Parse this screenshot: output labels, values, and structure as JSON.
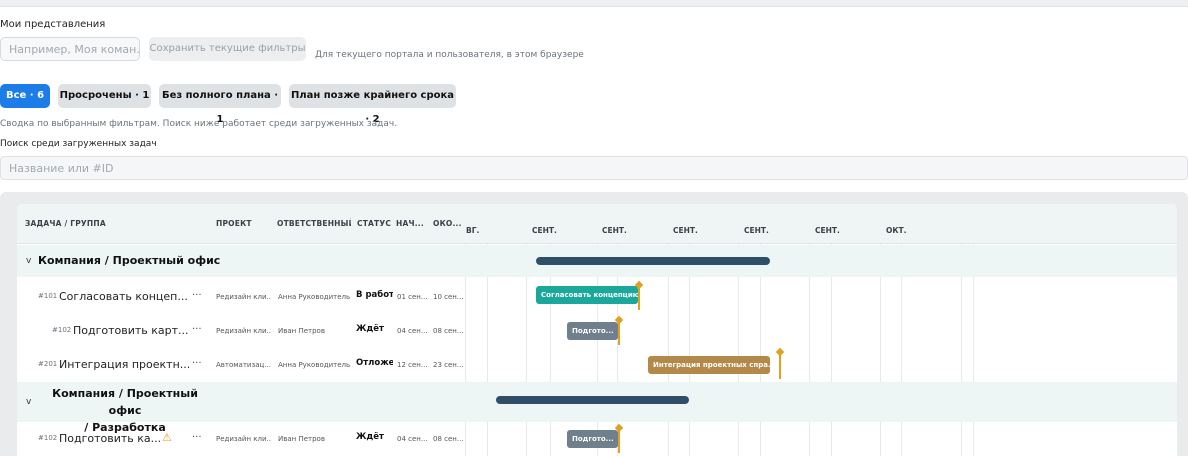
{
  "views": {
    "label": "Мои представления",
    "input_placeholder": "Например, Моя коман...",
    "save_button": "Сохранить текущие фильтры",
    "hint": "Для текущего портала и пользователя, в этом браузере"
  },
  "filters": [
    {
      "label": "Все · 6",
      "active": true
    },
    {
      "label": "Просрочены · 1",
      "active": false
    },
    {
      "label": "Без полного плана · 1",
      "active": false
    },
    {
      "label": "План позже крайнего срока · 2",
      "active": false
    }
  ],
  "summary": "Сводка по выбранным фильтрам. Поиск ниже работает среди загруженных задач.",
  "search": {
    "label": "Поиск среди загруженных задач",
    "placeholder": "Название или #ID"
  },
  "gantt": {
    "columns": {
      "task": "ЗАДАЧА / ГРУППА",
      "project": "ПРОЕКТ",
      "assignee": "ОТВЕТСТВЕННЫЙ",
      "status": "СТАТУС",
      "start": "НАЧ...",
      "end": "ОКО..."
    },
    "timeline_labels": [
      "ВГ.",
      "СЕНТ.",
      "СЕНТ.",
      "СЕНТ.",
      "СЕНТ.",
      "СЕНТ.",
      "ОКТ."
    ],
    "groups": [
      {
        "chevron": "v",
        "title": "Компания / Проектный офис",
        "tasks": [
          {
            "id": "#101",
            "name": "Согласовать концеп...",
            "more": "···",
            "project": "Редизайн кли...",
            "assignee": "Анна Руководитель",
            "status": "В работе",
            "start": "01 сен...",
            "end": "10 сен...",
            "bar_label": "Согласовать концепцию...",
            "bar_color": "#1aa89c",
            "warning": false
          },
          {
            "id": "#102",
            "name": "Подготовить карт...",
            "more": "···",
            "project": "Редизайн кли...",
            "assignee": "Иван Петров",
            "status": "Ждёт",
            "start": "04 сен...",
            "end": "08 сен...",
            "bar_label": "Подгото...",
            "bar_color": "#6f7f8c",
            "warning": false
          },
          {
            "id": "#201",
            "name": "Интеграция проектн...",
            "more": "···",
            "project": "Автоматизац...",
            "assignee": "Анна Руководитель",
            "status": "Отложена",
            "start": "12 сен...",
            "end": "23 сен...",
            "bar_label": "Интеграция проектных спра...",
            "bar_color": "#b3894a",
            "warning": false
          }
        ]
      },
      {
        "chevron": "v",
        "title": "Компания / Проектный офис / Разработка",
        "title_line1": "Компания / Проектный офис",
        "title_line2": "/ Разработка",
        "tasks": [
          {
            "id": "#102",
            "name": "Подготовить ка...",
            "more": "···",
            "project": "Редизайн кли...",
            "assignee": "Иван Петров",
            "status": "Ждёт",
            "start": "04 сен...",
            "end": "08 сен...",
            "bar_label": "Подгото...",
            "bar_color": "#6f7f8c",
            "warning": true,
            "warning_icon": "warning-triangle-icon"
          }
        ]
      }
    ]
  }
}
